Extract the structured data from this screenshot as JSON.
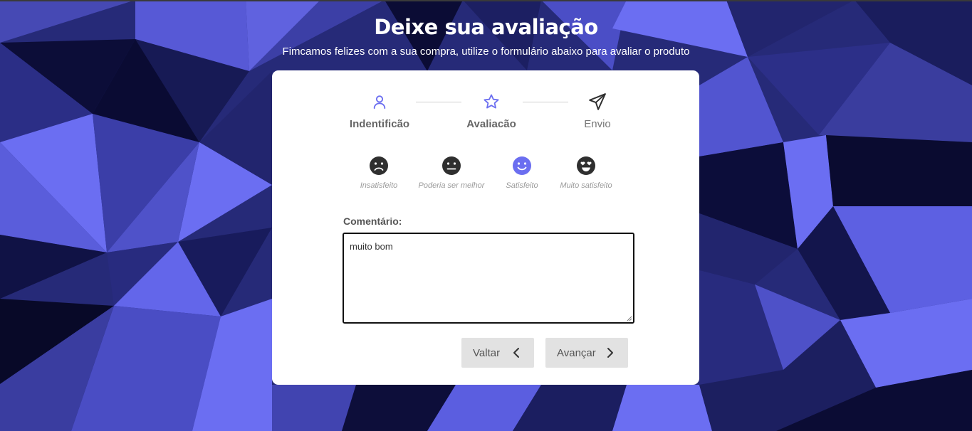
{
  "header": {
    "title": "Deixe sua avaliação",
    "subtitle": "Fimcamos felizes com a sua compra, utilize o formulário abaixo para avaliar o produto"
  },
  "steps": [
    {
      "label": "Indentificão",
      "icon": "user-icon",
      "state": "done"
    },
    {
      "label": "Avaliacão",
      "icon": "star-icon",
      "state": "active"
    },
    {
      "label": "Envio",
      "icon": "send-icon",
      "state": "pending"
    }
  ],
  "moods": [
    {
      "label": "Insatisfeito",
      "icon": "frown-face-icon",
      "selected": false
    },
    {
      "label": "Poderia ser melhor",
      "icon": "neutral-face-icon",
      "selected": false
    },
    {
      "label": "Satisfeito",
      "icon": "smile-face-icon",
      "selected": true
    },
    {
      "label": "Muito satisfeito",
      "icon": "heart-eyes-face-icon",
      "selected": false
    }
  ],
  "comment": {
    "label": "Comentário:",
    "value": "muito bom"
  },
  "buttons": {
    "back_label": "Valtar",
    "next_label": "Avançar"
  },
  "colors": {
    "accent": "#6b6ef0",
    "dark_icon": "#2f2f2f",
    "button_bg": "#e2e2e2",
    "bg_dark": "#0d0e3a",
    "bg_light": "#6b6ef2"
  }
}
